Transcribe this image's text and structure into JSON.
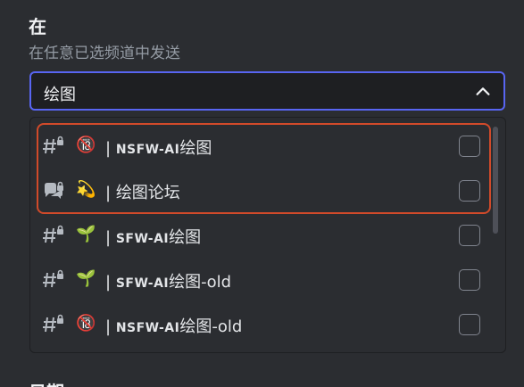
{
  "section": {
    "title": "在",
    "subtitle": "在任意已选频道中发送"
  },
  "select": {
    "value": "绘图"
  },
  "options": [
    {
      "icon": "text-channel-locked-icon",
      "emoji": "🔞",
      "sep": "|",
      "caps": "NSFW-AI",
      "name": "绘图",
      "checked": false
    },
    {
      "icon": "forum-channel-locked-icon",
      "emoji": "💫",
      "sep": "|",
      "caps": "",
      "name": "绘图论坛",
      "checked": false
    },
    {
      "icon": "text-channel-locked-icon",
      "emoji": "🌱",
      "sep": "|",
      "caps": "SFW-AI",
      "name": "绘图",
      "checked": false
    },
    {
      "icon": "text-channel-locked-icon",
      "emoji": "🌱",
      "sep": "|",
      "caps": "SFW-AI",
      "name": "绘图-old",
      "checked": false
    },
    {
      "icon": "text-channel-locked-icon",
      "emoji": "🔞",
      "sep": "|",
      "caps": "NSFW-AI",
      "name": "绘图-old",
      "checked": false
    }
  ],
  "next_section": {
    "title": "日期"
  },
  "colors": {
    "accent": "#5865f2",
    "highlight": "#d14a2a",
    "background": "#2b2d31"
  }
}
